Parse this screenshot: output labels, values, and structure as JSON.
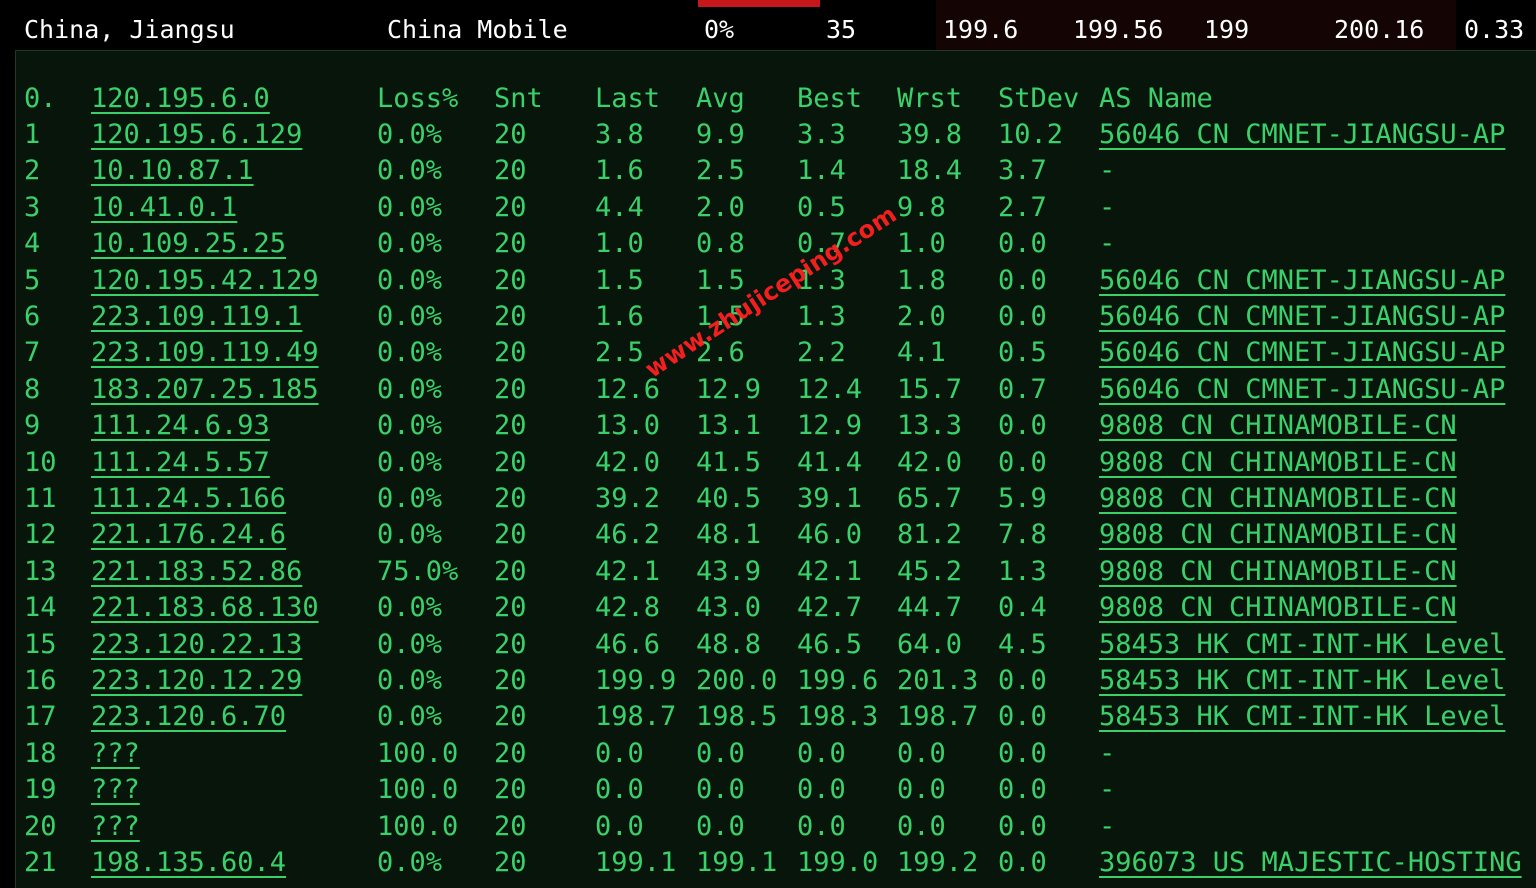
{
  "summary": {
    "location": "China, Jiangsu",
    "isp": "China Mobile",
    "loss": "0%",
    "sent": "35",
    "last": "199.6",
    "avg": "199.56",
    "best": "199",
    "worst": "200.16",
    "stdev": "0.33"
  },
  "watermark": "www.zhujiceping.com",
  "header": {
    "hop": "0.",
    "host": "120.195.6.0",
    "loss": "Loss%",
    "snt": "Snt",
    "last": "Last",
    "avg": "Avg",
    "best": "Best",
    "wrst": "Wrst",
    "stdev": "StDev",
    "as": "AS Name"
  },
  "rows": [
    {
      "hop": "1",
      "host": "120.195.6.129",
      "loss": "0.0%",
      "snt": "20",
      "last": "3.8",
      "avg": "9.9",
      "best": "3.3",
      "wrst": "39.8",
      "stdev": "10.2",
      "as": "56046 CN CMNET-JIANGSU-AP"
    },
    {
      "hop": "2",
      "host": "10.10.87.1",
      "loss": "0.0%",
      "snt": "20",
      "last": "1.6",
      "avg": "2.5",
      "best": "1.4",
      "wrst": "18.4",
      "stdev": "3.7",
      "as": "-"
    },
    {
      "hop": "3",
      "host": "10.41.0.1",
      "loss": "0.0%",
      "snt": "20",
      "last": "4.4",
      "avg": "2.0",
      "best": "0.5",
      "wrst": "9.8",
      "stdev": "2.7",
      "as": "-"
    },
    {
      "hop": "4",
      "host": "10.109.25.25",
      "loss": "0.0%",
      "snt": "20",
      "last": "1.0",
      "avg": "0.8",
      "best": "0.7",
      "wrst": "1.0",
      "stdev": "0.0",
      "as": "-"
    },
    {
      "hop": "5",
      "host": "120.195.42.129",
      "loss": "0.0%",
      "snt": "20",
      "last": "1.5",
      "avg": "1.5",
      "best": "1.3",
      "wrst": "1.8",
      "stdev": "0.0",
      "as": "56046 CN CMNET-JIANGSU-AP"
    },
    {
      "hop": "6",
      "host": "223.109.119.1",
      "loss": "0.0%",
      "snt": "20",
      "last": "1.6",
      "avg": "1.5",
      "best": "1.3",
      "wrst": "2.0",
      "stdev": "0.0",
      "as": "56046 CN CMNET-JIANGSU-AP"
    },
    {
      "hop": "7",
      "host": "223.109.119.49",
      "loss": "0.0%",
      "snt": "20",
      "last": "2.5",
      "avg": "2.6",
      "best": "2.2",
      "wrst": "4.1",
      "stdev": "0.5",
      "as": "56046 CN CMNET-JIANGSU-AP"
    },
    {
      "hop": "8",
      "host": "183.207.25.185",
      "loss": "0.0%",
      "snt": "20",
      "last": "12.6",
      "avg": "12.9",
      "best": "12.4",
      "wrst": "15.7",
      "stdev": "0.7",
      "as": "56046 CN CMNET-JIANGSU-AP"
    },
    {
      "hop": "9",
      "host": "111.24.6.93",
      "loss": "0.0%",
      "snt": "20",
      "last": "13.0",
      "avg": "13.1",
      "best": "12.9",
      "wrst": "13.3",
      "stdev": "0.0",
      "as": "9808  CN CHINAMOBILE-CN"
    },
    {
      "hop": "10",
      "host": "111.24.5.57",
      "loss": "0.0%",
      "snt": "20",
      "last": "42.0",
      "avg": "41.5",
      "best": "41.4",
      "wrst": "42.0",
      "stdev": "0.0",
      "as": "9808  CN CHINAMOBILE-CN"
    },
    {
      "hop": "11",
      "host": "111.24.5.166",
      "loss": "0.0%",
      "snt": "20",
      "last": "39.2",
      "avg": "40.5",
      "best": "39.1",
      "wrst": "65.7",
      "stdev": "5.9",
      "as": "9808  CN CHINAMOBILE-CN"
    },
    {
      "hop": "12",
      "host": "221.176.24.6",
      "loss": "0.0%",
      "snt": "20",
      "last": "46.2",
      "avg": "48.1",
      "best": "46.0",
      "wrst": "81.2",
      "stdev": "7.8",
      "as": "9808  CN CHINAMOBILE-CN"
    },
    {
      "hop": "13",
      "host": "221.183.52.86",
      "loss": "75.0%",
      "snt": "20",
      "last": "42.1",
      "avg": "43.9",
      "best": "42.1",
      "wrst": "45.2",
      "stdev": "1.3",
      "as": "9808  CN CHINAMOBILE-CN"
    },
    {
      "hop": "14",
      "host": "221.183.68.130",
      "loss": "0.0%",
      "snt": "20",
      "last": "42.8",
      "avg": "43.0",
      "best": "42.7",
      "wrst": "44.7",
      "stdev": "0.4",
      "as": "9808  CN CHINAMOBILE-CN"
    },
    {
      "hop": "15",
      "host": "223.120.22.13",
      "loss": "0.0%",
      "snt": "20",
      "last": "46.6",
      "avg": "48.8",
      "best": "46.5",
      "wrst": "64.0",
      "stdev": "4.5",
      "as": "58453 HK CMI-INT-HK Level"
    },
    {
      "hop": "16",
      "host": "223.120.12.29",
      "loss": "0.0%",
      "snt": "20",
      "last": "199.9",
      "avg": "200.0",
      "best": "199.6",
      "wrst": "201.3",
      "stdev": "0.0",
      "as": "58453 HK CMI-INT-HK Level"
    },
    {
      "hop": "17",
      "host": "223.120.6.70",
      "loss": "0.0%",
      "snt": "20",
      "last": "198.7",
      "avg": "198.5",
      "best": "198.3",
      "wrst": "198.7",
      "stdev": "0.0",
      "as": "58453 HK CMI-INT-HK Level"
    },
    {
      "hop": "18",
      "host": "???",
      "loss": "100.0",
      "snt": "20",
      "last": "0.0",
      "avg": "0.0",
      "best": "0.0",
      "wrst": "0.0",
      "stdev": "0.0",
      "as": "-"
    },
    {
      "hop": "19",
      "host": "???",
      "loss": "100.0",
      "snt": "20",
      "last": "0.0",
      "avg": "0.0",
      "best": "0.0",
      "wrst": "0.0",
      "stdev": "0.0",
      "as": "-"
    },
    {
      "hop": "20",
      "host": "???",
      "loss": "100.0",
      "snt": "20",
      "last": "0.0",
      "avg": "0.0",
      "best": "0.0",
      "wrst": "0.0",
      "stdev": "0.0",
      "as": "-"
    },
    {
      "hop": "21",
      "host": "198.135.60.4",
      "loss": "0.0%",
      "snt": "20",
      "last": "199.1",
      "avg": "199.1",
      "best": "199.0",
      "wrst": "199.2",
      "stdev": "0.0",
      "as": "396073 US MAJESTIC-HOSTING"
    }
  ]
}
